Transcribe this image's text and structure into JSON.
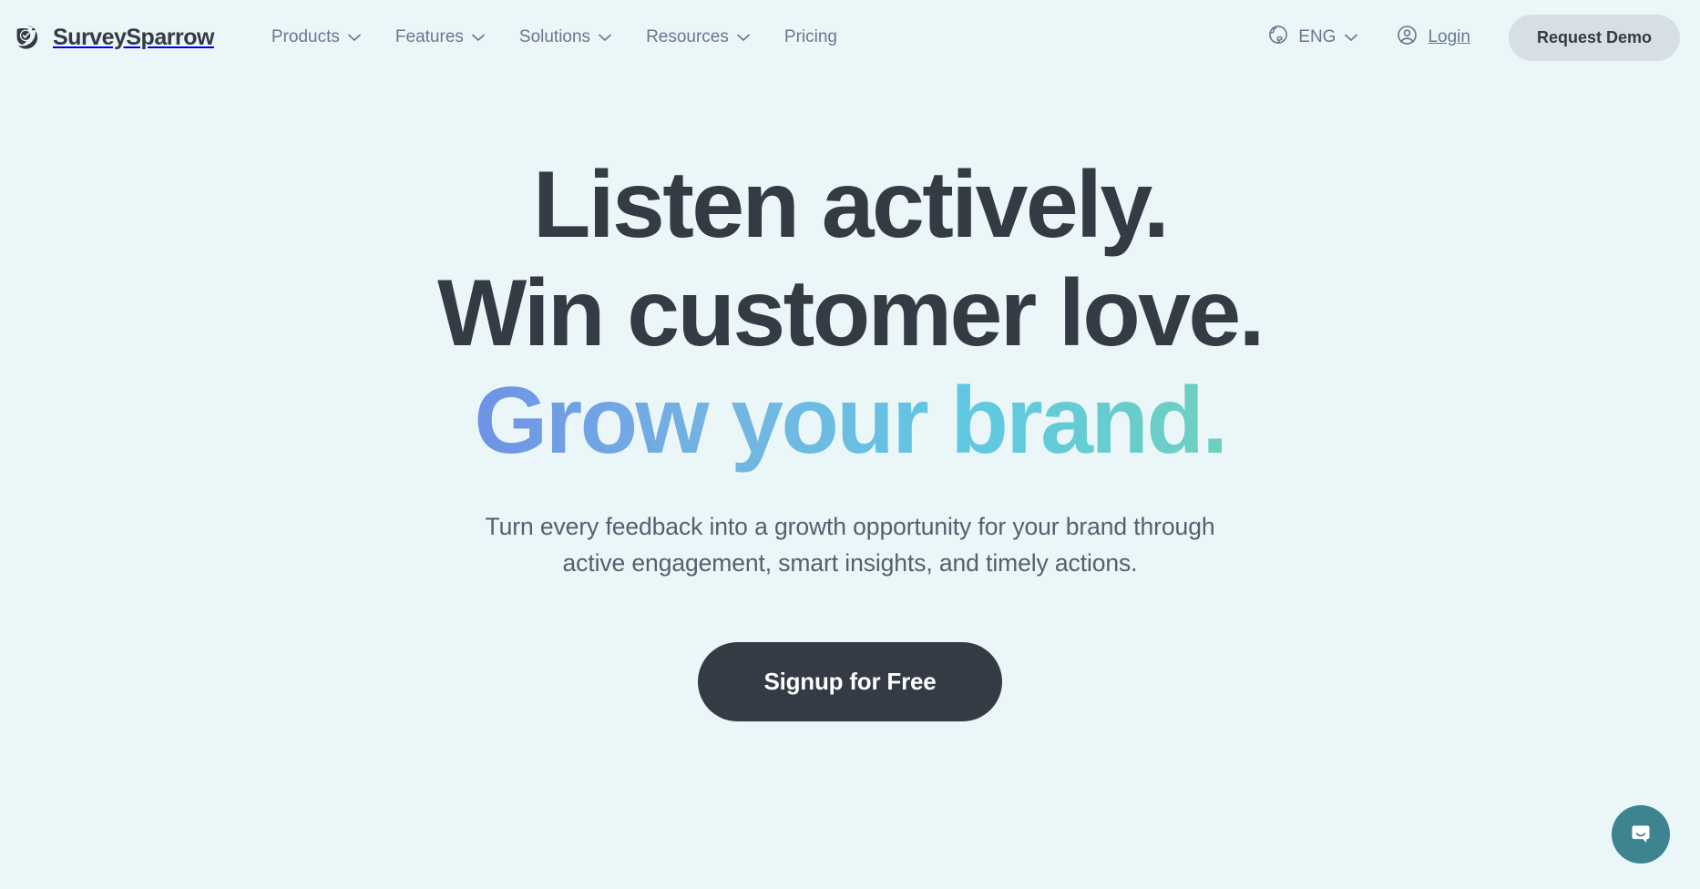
{
  "theme": {
    "background": "#eaf6f8",
    "text_dark": "#343b45",
    "nav_text": "#67798f",
    "subhead_text": "#54606e",
    "demo_button_bg": "#d6dfe4",
    "cta_bg": "#343b45",
    "chat_bg": "#3d8390",
    "gradient_start": "#6470e8",
    "gradient_mid": "#5fc9e1",
    "gradient_end": "#7ad085"
  },
  "header": {
    "brand": {
      "name": "SurveySparrow",
      "logo_icon": "sparrow-shield-check-icon"
    },
    "nav": [
      {
        "label": "Products",
        "has_dropdown": true
      },
      {
        "label": "Features",
        "has_dropdown": true
      },
      {
        "label": "Solutions",
        "has_dropdown": true
      },
      {
        "label": "Resources",
        "has_dropdown": true
      },
      {
        "label": "Pricing",
        "has_dropdown": false
      }
    ],
    "language": {
      "label": "ENG",
      "icon": "globe-icon",
      "has_dropdown": true
    },
    "login": {
      "label": "Login",
      "icon": "user-circle-icon"
    },
    "demo_button": {
      "label": "Request Demo"
    }
  },
  "hero": {
    "headline": {
      "line1": "Listen actively.",
      "line2": "Win customer love.",
      "line3": "Grow your brand."
    },
    "subhead": {
      "line1": "Turn every feedback into a growth opportunity for your brand through",
      "line2": "active engagement, smart insights, and timely actions."
    },
    "cta": {
      "label": "Signup for Free"
    }
  },
  "chat": {
    "icon": "chat-bubble-smile-icon",
    "aria_label": "Open chat"
  }
}
